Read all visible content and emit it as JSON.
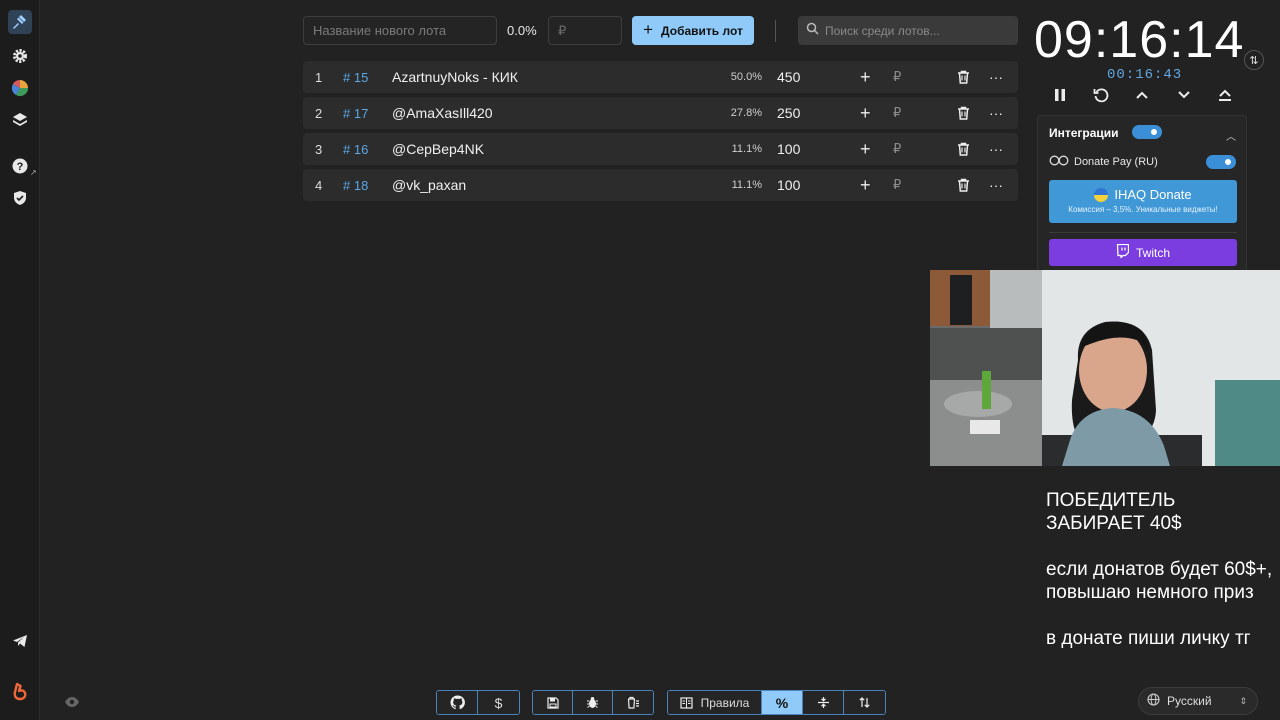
{
  "top_bar": {
    "lot_name_placeholder": "Название нового лота",
    "percent": "0.0%",
    "amount_placeholder": "₽",
    "add_button_label": "Добавить лот",
    "search_placeholder": "Поиск среди лотов..."
  },
  "lots": [
    {
      "index": "1",
      "number": "# 15",
      "name": "AzartnuyNoks - КИК",
      "percent": "50.0%",
      "amount": "450"
    },
    {
      "index": "2",
      "number": "# 17",
      "name": "@AmaXasIll420",
      "percent": "27.8%",
      "amount": "250"
    },
    {
      "index": "3",
      "number": "# 16",
      "name": "@CepBep4NK",
      "percent": "11.1%",
      "amount": "100"
    },
    {
      "index": "4",
      "number": "# 18",
      "name": "@vk_paxan",
      "percent": "11.1%",
      "amount": "100"
    }
  ],
  "lot_row_icons": {
    "add": "+",
    "currency": "₽",
    "more": "···"
  },
  "timer": {
    "main": "09:16:14",
    "secondary": "00:16:43"
  },
  "integrations": {
    "title": "Интеграции",
    "donate_pay_label": "Donate Pay (RU)",
    "ihaq_title": "IHAQ Donate",
    "ihaq_subtitle": "Комиссия – 3,5%. Уникальные виджеты!",
    "twitch_label": "Twitch"
  },
  "overlay": {
    "line1": "ПОБЕДИТЕЛЬ",
    "line2": "ЗАБИРАЕТ 40$",
    "para2": "если донатов будет 60$+, повышаю немного приз",
    "para3": "в донате пиши личку тг"
  },
  "language": {
    "selected": "Русский"
  },
  "bottom_toolbar": {
    "rules_label": "Правила"
  },
  "colors": {
    "accent": "#90caf9",
    "lot_number": "#5aa7e6",
    "twitch": "#7b3de0",
    "ihaq": "#4098d6",
    "timer_secondary": "#62a6e0"
  }
}
